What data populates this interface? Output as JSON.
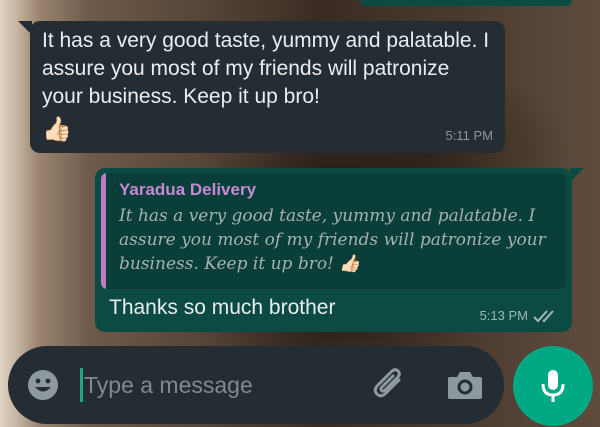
{
  "messages": {
    "incoming": {
      "text": "It has a very good taste, yummy and palatable. I assure you most of my friends will patronize your business. Keep it up bro!",
      "emoji": "👍🏻",
      "time": "5:11 PM"
    },
    "outgoing": {
      "quote_author": "Yaradua Delivery",
      "quote_text": "It has a very good taste, yummy and palatable. I assure you most of my friends will patronize your business. Keep it up bro! 👍🏻",
      "text": "Thanks so much brother",
      "time": "5:13 PM",
      "status": "read"
    }
  },
  "composer": {
    "placeholder": "Type a message",
    "emoji_icon": "smiley-icon",
    "attach_icon": "paperclip-icon",
    "camera_icon": "camera-icon",
    "mic_icon": "microphone-icon"
  },
  "colors": {
    "incoming_bubble": "#242d33",
    "outgoing_bubble": "#0b4b43",
    "accent": "#00a884",
    "quote_author": "#c48ad4"
  }
}
